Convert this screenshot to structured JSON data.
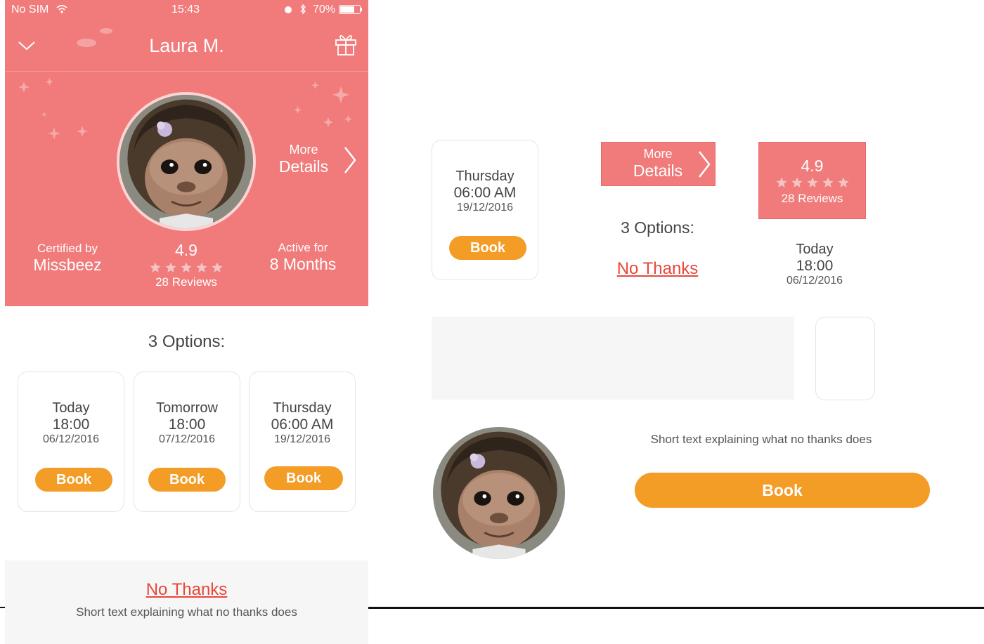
{
  "status_bar": {
    "carrier": "No SIM",
    "time": "15:43",
    "battery": "70%"
  },
  "header": {
    "title": "Laura M."
  },
  "hero": {
    "more_top": "More",
    "more_bottom": "Details",
    "certified_label": "Certified by",
    "certified_value": "Missbeez",
    "rating": "4.9",
    "reviews": "28 Reviews",
    "stars": 5,
    "active_label": "Active for",
    "active_value": "8 Months"
  },
  "options": {
    "heading": "3 Options:",
    "cards": [
      {
        "day": "Today",
        "time": "18:00",
        "date": "06/12/2016",
        "button": "Book"
      },
      {
        "day": "Tomorrow",
        "time": "18:00",
        "date": "07/12/2016",
        "button": "Book"
      },
      {
        "day": "Thursday",
        "time": "06:00 AM",
        "date": "19/12/2016",
        "button": "Book"
      }
    ]
  },
  "no_thanks": {
    "link": "No Thanks",
    "text": "Short text explaining what no thanks does"
  },
  "components": {
    "card": {
      "day": "Thursday",
      "time": "06:00 AM",
      "date": "19/12/2016",
      "button": "Book"
    },
    "more_details": {
      "top": "More",
      "bottom": "Details"
    },
    "options_heading": "3 Options:",
    "no_thanks_link": "No Thanks",
    "rating_box": {
      "rating": "4.9",
      "reviews": "28 Reviews"
    },
    "today": {
      "day": "Today",
      "time": "18:00",
      "date": "06/12/2016"
    },
    "explain_text": "Short text explaining what no thanks does",
    "big_button": "Book"
  },
  "colors": {
    "brand_pink": "#f07b7a",
    "book_orange": "#f39c26",
    "link_red": "#e8473a"
  },
  "icons": [
    "wifi-icon",
    "alarm-icon",
    "bluetooth-icon",
    "battery-icon",
    "chevron-down-icon",
    "gift-icon",
    "chevron-right-icon",
    "star-icon",
    "monkey-avatar"
  ]
}
